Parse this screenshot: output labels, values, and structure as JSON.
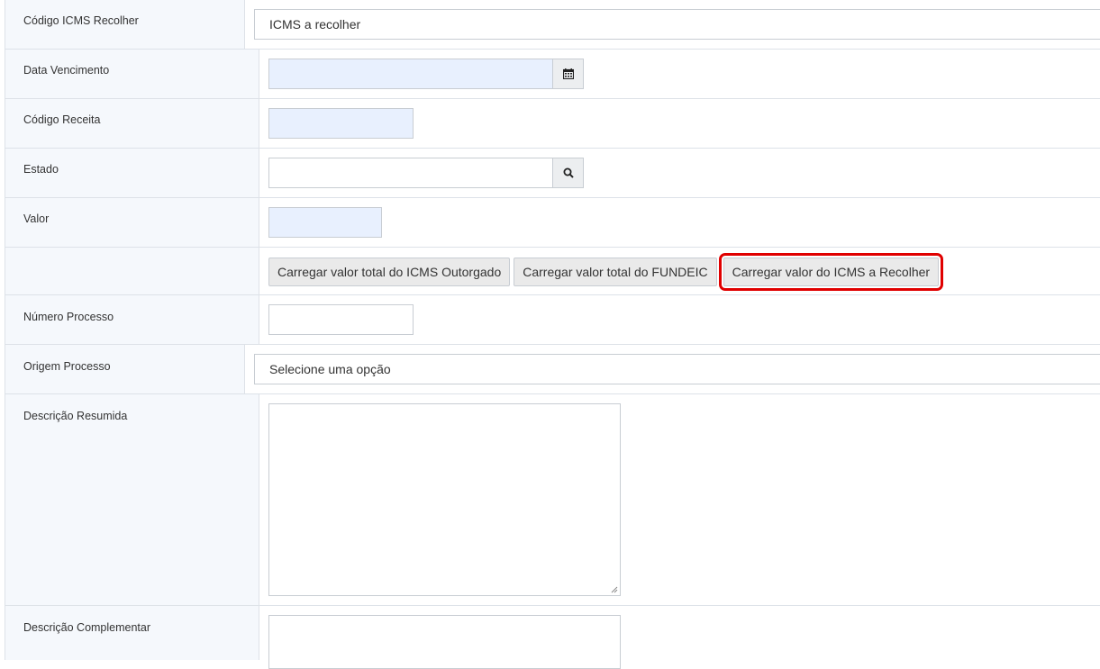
{
  "fields": {
    "codigo_icms": {
      "label": "Código ICMS Recolher",
      "value": "ICMS a recolher"
    },
    "data_vencimento": {
      "label": "Data Vencimento",
      "value": ""
    },
    "codigo_receita": {
      "label": "Código Receita",
      "value": ""
    },
    "estado": {
      "label": "Estado",
      "value": ""
    },
    "valor": {
      "label": "Valor",
      "value": ""
    },
    "numero_processo": {
      "label": "Número Processo",
      "value": ""
    },
    "origem_processo": {
      "label": "Origem Processo",
      "value": "Selecione uma opção"
    },
    "descricao_resumida": {
      "label": "Descrição Resumida",
      "value": ""
    },
    "descricao_complementar": {
      "label": "Descrição Complementar",
      "value": ""
    }
  },
  "buttons": {
    "icms_outorgado": "Carregar valor total do ICMS Outorgado",
    "fundeic": "Carregar valor total do FUNDEIC",
    "icms_recolher": "Carregar valor do ICMS a Recolher"
  },
  "icons": {
    "calendar": "calendar-icon",
    "search": "search-icon"
  },
  "colors": {
    "highlight": "#e00000",
    "autofill_bg": "#e8f0fe",
    "label_bg": "#f5f8fc"
  }
}
